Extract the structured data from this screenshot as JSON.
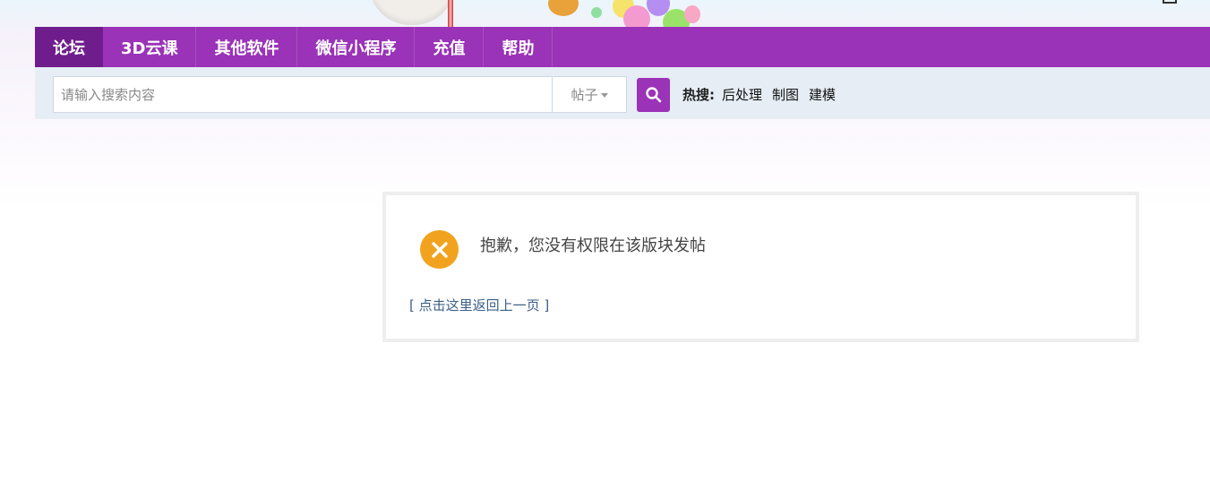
{
  "nav": {
    "items": [
      {
        "label": "论坛",
        "active": true
      },
      {
        "label": "3D云课"
      },
      {
        "label": "其他软件"
      },
      {
        "label": "微信小程序"
      },
      {
        "label": "充值"
      },
      {
        "label": "帮助"
      }
    ]
  },
  "search": {
    "placeholder": "请输入搜索内容",
    "type_selected": "帖子",
    "search_icon": "search-icon",
    "hot_label": "热搜:",
    "hot_items": [
      "后处理",
      "制图",
      "建模"
    ]
  },
  "alert": {
    "icon": "error-x-icon",
    "message": "抱歉，您没有权限在该版块发帖",
    "back_link": "[ 点击这里返回上一页 ]"
  },
  "colors": {
    "brand_purple": "#9a33b7",
    "active_tab": "#6f1d8c",
    "warning_orange": "#f1a31f",
    "link_blue": "#3b5f86"
  }
}
